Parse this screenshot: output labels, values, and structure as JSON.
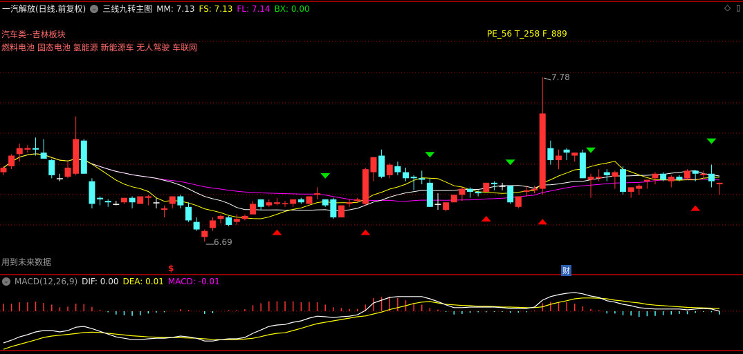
{
  "header": {
    "stock": "一汽解放(日线.前复权)",
    "indicator": "三线九转主图",
    "mm": "MM: 7.13",
    "fs": "FS: 7.13",
    "fl": "FL: 7.14",
    "bx": "BX: 0.00"
  },
  "info": {
    "sector": "汽车类--吉林板块",
    "concepts": "燃料电池 固态电池 氢能源 新能源车 无人驾驶 车联网",
    "valuation": "PE_56 T_258 F_889",
    "future_warning": "用到未来数据"
  },
  "markers": {
    "high_label": "7.78",
    "low_label": "6.69",
    "s_marker": "$",
    "cai_badge": "财"
  },
  "macd_header": {
    "title": "MACD(12,26,9)",
    "dif": "DIF: 0.00",
    "dea": "DEA: 0.01",
    "macd": "MACD: -0.01"
  },
  "colors": {
    "up": "#ff3232",
    "down": "#54fcfc",
    "doji": "#ffffff",
    "ma_fast": "#ffff00",
    "ma_mid": "#ffffff",
    "ma_slow": "#ff00ff",
    "grid": "#a00000"
  },
  "chart_data": {
    "type": "candlestick",
    "price_range": [
      6.69,
      7.78
    ],
    "ma_periods": {
      "yellow": 10,
      "white": 20,
      "magenta": 40
    },
    "ohlc": [
      [
        7.15,
        7.19,
        7.13,
        7.18
      ],
      [
        7.19,
        7.27,
        7.17,
        7.26
      ],
      [
        7.27,
        7.34,
        7.22,
        7.31
      ],
      [
        7.3,
        7.33,
        7.28,
        7.31
      ],
      [
        7.31,
        7.38,
        7.26,
        7.3
      ],
      [
        7.28,
        7.37,
        7.24,
        7.24
      ],
      [
        7.23,
        7.24,
        7.11,
        7.13
      ],
      [
        7.11,
        7.14,
        7.09,
        7.11
      ],
      [
        7.12,
        7.22,
        7.11,
        7.18
      ],
      [
        7.14,
        7.52,
        7.13,
        7.37
      ],
      [
        7.36,
        7.37,
        7.14,
        7.14
      ],
      [
        7.09,
        7.11,
        6.91,
        6.94
      ],
      [
        6.98,
        6.99,
        6.93,
        6.97
      ],
      [
        6.96,
        6.97,
        6.92,
        6.95
      ],
      [
        6.94,
        6.96,
        6.93,
        6.94
      ],
      [
        6.95,
        6.98,
        6.94,
        6.98
      ],
      [
        6.98,
        6.99,
        6.91,
        6.95
      ],
      [
        6.94,
        6.99,
        6.94,
        6.99
      ],
      [
        6.98,
        7.0,
        6.93,
        6.99
      ],
      [
        6.95,
        6.98,
        6.91,
        6.95
      ],
      [
        6.9,
        6.93,
        6.85,
        6.91
      ],
      [
        6.94,
        6.99,
        6.91,
        6.99
      ],
      [
        6.99,
        7.0,
        6.91,
        6.93
      ],
      [
        6.92,
        6.95,
        6.82,
        6.83
      ],
      [
        6.82,
        6.85,
        6.76,
        6.77
      ],
      [
        6.72,
        6.77,
        6.69,
        6.76
      ],
      [
        6.78,
        6.85,
        6.76,
        6.83
      ],
      [
        6.84,
        6.87,
        6.81,
        6.86
      ],
      [
        6.85,
        6.86,
        6.79,
        6.8
      ],
      [
        6.82,
        6.87,
        6.8,
        6.84
      ],
      [
        6.84,
        6.87,
        6.83,
        6.86
      ],
      [
        6.87,
        6.96,
        6.87,
        6.94
      ],
      [
        6.97,
        6.97,
        6.9,
        6.92
      ],
      [
        6.93,
        6.97,
        6.92,
        6.95
      ],
      [
        6.94,
        6.98,
        6.93,
        6.95
      ],
      [
        6.94,
        6.96,
        6.92,
        6.945
      ],
      [
        6.94,
        6.97,
        6.92,
        6.97
      ],
      [
        6.97,
        6.98,
        6.94,
        6.95
      ],
      [
        6.94,
        6.99,
        6.94,
        6.99
      ],
      [
        7.0,
        7.05,
        6.97,
        7.01
      ],
      [
        6.97,
        6.97,
        6.92,
        6.93
      ],
      [
        6.97,
        6.98,
        6.84,
        6.85
      ],
      [
        6.85,
        6.93,
        6.85,
        6.93
      ],
      [
        6.94,
        6.97,
        6.92,
        6.95
      ],
      [
        6.96,
        6.98,
        6.95,
        6.97
      ],
      [
        6.94,
        7.18,
        6.93,
        7.17
      ],
      [
        7.15,
        7.25,
        7.09,
        7.25
      ],
      [
        7.26,
        7.3,
        7.11,
        7.12
      ],
      [
        7.13,
        7.21,
        7.11,
        7.2
      ],
      [
        7.19,
        7.22,
        7.13,
        7.15
      ],
      [
        7.15,
        7.18,
        7.09,
        7.11
      ],
      [
        7.12,
        7.13,
        7.03,
        7.11
      ],
      [
        7.11,
        7.16,
        7.07,
        7.1
      ],
      [
        7.08,
        7.11,
        6.92,
        6.92
      ],
      [
        6.94,
        7.01,
        6.9,
        6.94
      ],
      [
        6.9,
        6.95,
        6.89,
        6.95
      ],
      [
        6.95,
        7.0,
        6.95,
        7.0
      ],
      [
        7.0,
        7.05,
        6.96,
        7.04
      ],
      [
        7.04,
        7.05,
        6.98,
        7.02
      ],
      [
        7.02,
        7.03,
        6.99,
        7.01
      ],
      [
        7.02,
        7.08,
        7.02,
        7.08
      ],
      [
        7.08,
        7.09,
        7.03,
        7.07
      ],
      [
        7.06,
        7.08,
        7.03,
        7.06
      ],
      [
        7.06,
        7.06,
        6.94,
        6.95
      ],
      [
        6.92,
        6.99,
        6.91,
        6.99
      ],
      [
        7.02,
        7.06,
        6.99,
        7.03
      ],
      [
        7.03,
        7.06,
        7.01,
        7.04
      ],
      [
        7.04,
        7.78,
        7.0,
        7.54
      ],
      [
        7.31,
        7.36,
        7.2,
        7.23
      ],
      [
        7.23,
        7.3,
        7.17,
        7.26
      ],
      [
        7.3,
        7.31,
        7.23,
        7.28
      ],
      [
        7.26,
        7.28,
        7.22,
        7.28
      ],
      [
        7.28,
        7.3,
        7.11,
        7.11
      ],
      [
        7.1,
        7.14,
        6.98,
        7.12
      ],
      [
        7.11,
        7.17,
        7.09,
        7.12
      ],
      [
        7.15,
        7.17,
        7.09,
        7.13
      ],
      [
        7.12,
        7.16,
        7.04,
        7.15
      ],
      [
        7.17,
        7.19,
        7.0,
        7.02
      ],
      [
        7.02,
        7.05,
        6.98,
        7.05
      ],
      [
        7.04,
        7.07,
        7.0,
        7.06
      ],
      [
        7.09,
        7.1,
        7.04,
        7.1
      ],
      [
        7.11,
        7.15,
        7.07,
        7.14
      ],
      [
        7.14,
        7.15,
        7.09,
        7.1
      ],
      [
        7.09,
        7.13,
        7.05,
        7.12
      ],
      [
        7.12,
        7.13,
        7.09,
        7.1
      ],
      [
        7.11,
        7.17,
        7.1,
        7.16
      ],
      [
        7.16,
        7.16,
        7.09,
        7.14
      ],
      [
        7.13,
        7.16,
        7.11,
        7.14
      ],
      [
        7.14,
        7.2,
        7.05,
        7.09
      ],
      [
        7.07,
        7.08,
        7.0,
        7.08
      ]
    ],
    "sell_signals": [
      40,
      53,
      63,
      73,
      88
    ],
    "buy_signals": [
      34,
      45,
      60,
      67,
      86
    ],
    "high_index": 67,
    "low_index": 25,
    "s_marker_index": 21,
    "cai_index": 70,
    "macd": {
      "range": [
        -0.14,
        0.08
      ],
      "dif": [
        -0.115,
        -0.105,
        -0.093,
        -0.085,
        -0.075,
        -0.07,
        -0.07,
        -0.075,
        -0.07,
        -0.058,
        -0.055,
        -0.063,
        -0.073,
        -0.083,
        -0.093,
        -0.098,
        -0.103,
        -0.103,
        -0.1,
        -0.098,
        -0.098,
        -0.095,
        -0.09,
        -0.093,
        -0.098,
        -0.108,
        -0.108,
        -0.103,
        -0.1,
        -0.1,
        -0.095,
        -0.08,
        -0.068,
        -0.055,
        -0.05,
        -0.048,
        -0.04,
        -0.035,
        -0.025,
        -0.018,
        -0.02,
        -0.023,
        -0.02,
        -0.018,
        -0.013,
        0.003,
        0.03,
        0.04,
        0.05,
        0.053,
        0.053,
        0.053,
        0.053,
        0.045,
        0.035,
        0.023,
        0.013,
        0.013,
        0.015,
        0.015,
        0.015,
        0.015,
        0.013,
        0.01,
        0.01,
        0.01,
        0.015,
        0.04,
        0.053,
        0.06,
        0.065,
        0.068,
        0.063,
        0.055,
        0.05,
        0.038,
        0.033,
        0.025,
        0.02,
        0.013,
        0.01,
        0.008,
        0.008,
        0.008,
        0.008,
        0.005,
        0.008,
        0.01,
        0.008,
        0.0
      ],
      "dea": [
        -0.138,
        -0.128,
        -0.12,
        -0.112,
        -0.104,
        -0.095,
        -0.09,
        -0.087,
        -0.084,
        -0.081,
        -0.077,
        -0.076,
        -0.077,
        -0.08,
        -0.083,
        -0.086,
        -0.089,
        -0.091,
        -0.093,
        -0.094,
        -0.095,
        -0.095,
        -0.096,
        -0.097,
        -0.098,
        -0.1,
        -0.102,
        -0.103,
        -0.103,
        -0.103,
        -0.101,
        -0.098,
        -0.092,
        -0.085,
        -0.08,
        -0.078,
        -0.07,
        -0.062,
        -0.053,
        -0.045,
        -0.04,
        -0.035,
        -0.03,
        -0.025,
        -0.02,
        -0.017,
        -0.01,
        -0.003,
        0.006,
        0.013,
        0.02,
        0.028,
        0.033,
        0.035,
        0.03,
        0.025,
        0.023,
        0.021,
        0.02,
        0.018,
        0.018,
        0.017,
        0.015,
        0.015,
        0.014,
        0.013,
        0.013,
        0.016,
        0.025,
        0.032,
        0.038,
        0.045,
        0.048,
        0.048,
        0.047,
        0.045,
        0.04,
        0.037,
        0.033,
        0.03,
        0.025,
        0.022,
        0.02,
        0.018,
        0.016,
        0.014,
        0.013,
        0.012,
        0.011,
        0.01
      ]
    }
  }
}
